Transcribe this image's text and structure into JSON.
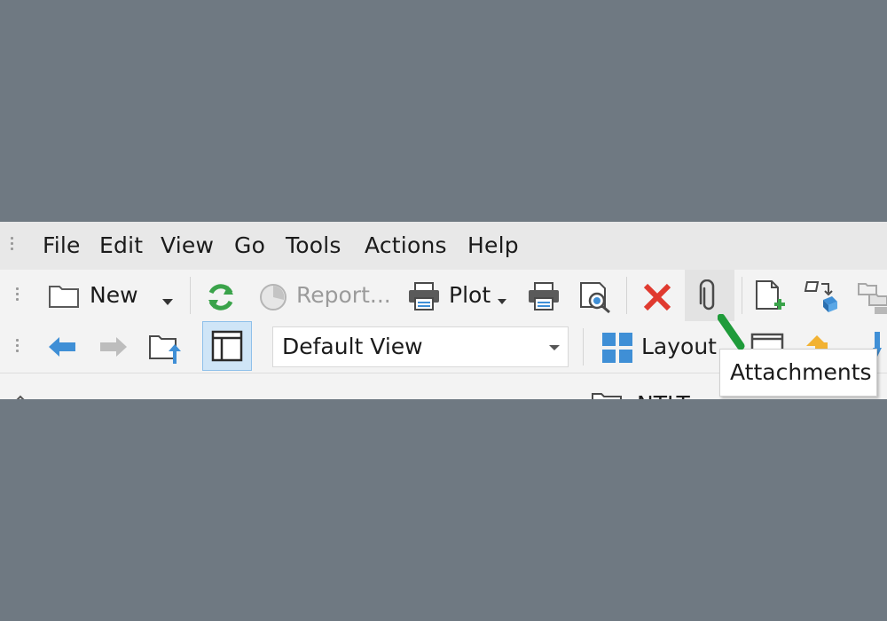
{
  "menu": {
    "items": [
      "File",
      "Edit",
      "View",
      "Go",
      "Tools",
      "Actions",
      "Help"
    ]
  },
  "toolbar1": {
    "new_label": "New",
    "report_label": "Report...",
    "plot_label": "Plot"
  },
  "toolbar2": {
    "view_select_value": "Default View",
    "layout_label": "Layout"
  },
  "tooltip": {
    "text": "Attachments"
  },
  "bottom": {
    "partial_text": "NTLT"
  },
  "colors": {
    "background": "#6f7982",
    "accent_blue": "#3f8fd6",
    "refresh_green": "#3aa34a",
    "delete_red": "#e03a2f",
    "annotation_green": "#1f9b3a"
  }
}
